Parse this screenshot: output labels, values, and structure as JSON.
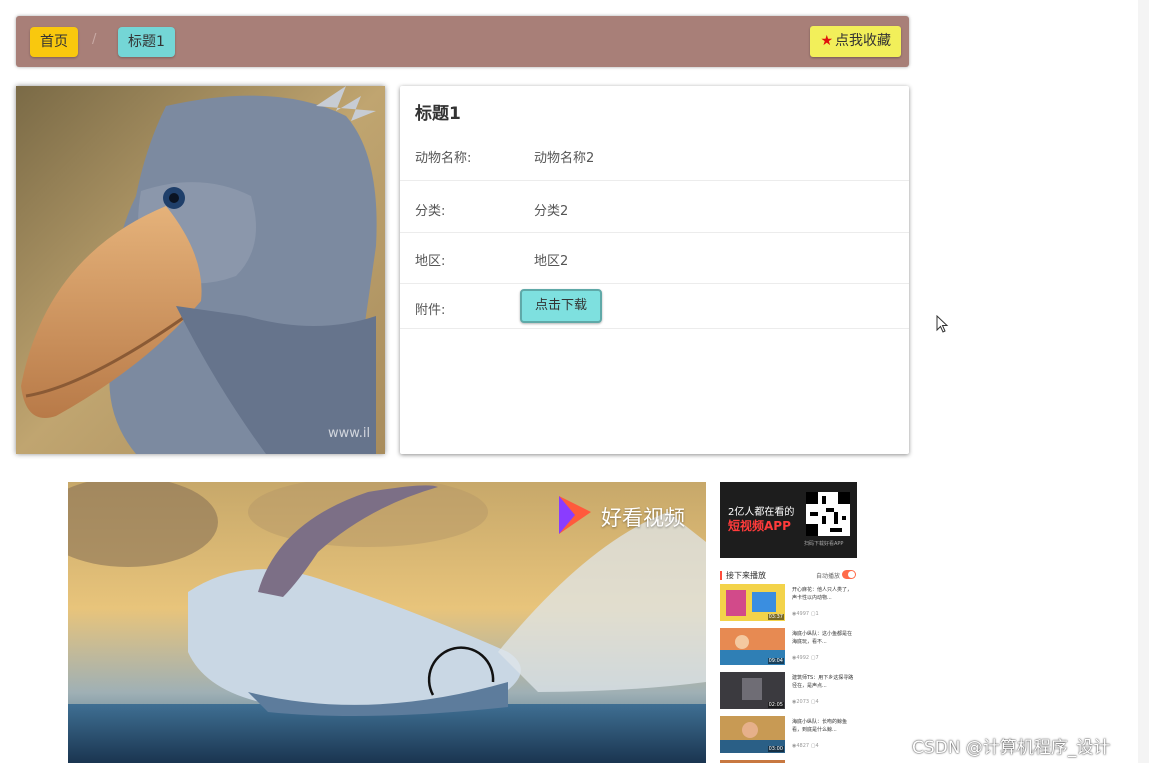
{
  "breadcrumb": {
    "home": "首页",
    "separator": "/",
    "current": "标题1"
  },
  "favorite": {
    "icon": "star-icon",
    "label": "点我收藏"
  },
  "detail": {
    "title": "标题1",
    "rows": [
      {
        "label": "动物名称:",
        "value": "动物名称2"
      },
      {
        "label": "分类:",
        "value": "分类2"
      },
      {
        "label": "地区:",
        "value": "地区2"
      },
      {
        "label": "附件:",
        "button": "点击下载"
      }
    ]
  },
  "image": {
    "watermark": "www.il"
  },
  "video": {
    "logo_text": "好看视频",
    "side": {
      "ad_line1": "2亿人都在看的",
      "ad_line2": "短视频APP",
      "ad_qr_caption": "扫码下载好看APP",
      "next_label": "接下来播放",
      "autoplay_label": "自动播放",
      "items": [
        {
          "title": "开心麻花：他人只人类了，声卡性以内动物...",
          "duration": "03:37",
          "views": "4997",
          "comments": "1"
        },
        {
          "title": "海底小纵队：这小鱼都是在海底玩，看不...",
          "duration": "09:04",
          "views": "4992",
          "comments": "7"
        },
        {
          "title": "建筑师TS：用下乡这探寻路径在，是声点...",
          "duration": "02:05",
          "views": "2073",
          "comments": "4"
        },
        {
          "title": "海底小纵队：长吻的鲸鱼看，到底是什么鲸...",
          "duration": "03:00",
          "views": "4827",
          "comments": "4"
        }
      ]
    }
  },
  "watermark": "CSDN @计算机程序_设计",
  "colors": {
    "topbar": "#a87f78",
    "home_crumb": "#f9c80e",
    "current_crumb": "#74d6d6",
    "favorite_button": "#f2ef5a",
    "download_button": "#7ee0df"
  }
}
